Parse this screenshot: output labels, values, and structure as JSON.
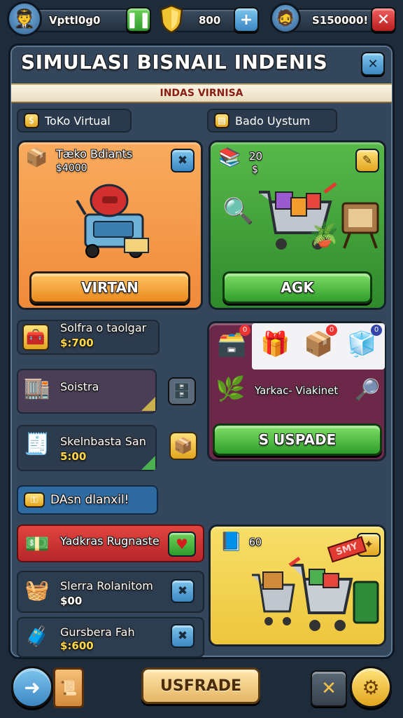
{
  "top_bar": {
    "player_value": "Vpttl0g0",
    "gold_value": "800",
    "other_value": "S150000!",
    "avatar_icon": "player-avatar-icon",
    "shield_icon": "shield-icon",
    "pause_icon": "pause-icon",
    "plus_icon": "plus-icon",
    "close_icon": "close-icon"
  },
  "panel": {
    "title": "SIMULASI BISNAIL INDENIS",
    "ribbon": "INDAS VIRNISA",
    "close_label": "✕"
  },
  "sections": {
    "left_tab": "ToKo Virtual",
    "right_tab": "Bado Uystum",
    "lower_tab": "DAsn dlanxil!"
  },
  "cards": {
    "orange": {
      "title": "Tæko Bdiants",
      "value": "$4000",
      "button": "VIRTAN"
    },
    "green": {
      "count": "20",
      "sub": "$",
      "button": "AGK"
    },
    "yellow": {
      "count": "60",
      "badge": "SMY"
    }
  },
  "mid_rows": [
    {
      "label": "Solfra o taolgar",
      "value": "$:700"
    },
    {
      "label": "Soistra",
      "value": ""
    },
    {
      "label": "Skelnbasta San",
      "value": "5:00"
    }
  ],
  "market": {
    "label": "Yarkac- Viakinet",
    "button": "S USPADE",
    "badges": [
      "0",
      "0",
      "0"
    ]
  },
  "list_rows": [
    {
      "label": "Yadkras Rugnaste",
      "value": ""
    },
    {
      "label": "Slerra Rolanitom",
      "value": "$00"
    },
    {
      "label": "Gursbera Fah",
      "value": "$:600"
    }
  ],
  "bottom_bar": {
    "upgrade_button": "USFRADE",
    "close_label": "✕"
  },
  "colors": {
    "panel": "#34465b",
    "accent_green": "#2f9d2b",
    "accent_orange": "#f08a3a",
    "accent_red": "#b6262a",
    "ribbon_text": "#8a1e12"
  }
}
